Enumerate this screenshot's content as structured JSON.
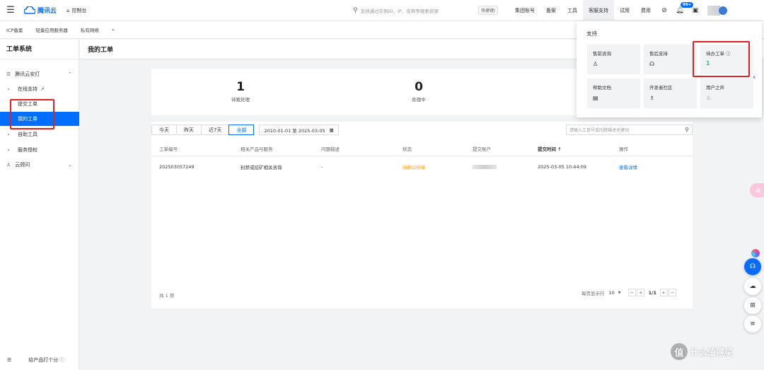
{
  "topbar": {
    "brand": "腾讯云",
    "console": "控制台",
    "search_placeholder": "支持通过实例ID、IP、名称等搜索资源",
    "shortcut": "快捷键/",
    "nav": [
      "集团账号",
      "备案",
      "工具",
      "客服支持",
      "试用",
      "费用"
    ],
    "notice_badge": "99+"
  },
  "subbar": {
    "items": [
      "ICP备案",
      "轻量应用服务器",
      "私有网络",
      "«"
    ]
  },
  "sidebar": {
    "title": "工单系统",
    "group": "腾讯云安灯",
    "items": [
      "在线支持",
      "提交工单",
      "我的工单",
      "自助工具",
      "服务授权",
      "云顾问"
    ],
    "bottom_label": "给产品打个分"
  },
  "main": {
    "title": "我的工单",
    "stats": [
      {
        "value": "1",
        "label": "待我处理"
      },
      {
        "value": "0",
        "label": "处理中"
      }
    ],
    "filters": [
      "今天",
      "昨天",
      "近7天",
      "全部"
    ],
    "date_range": "2010-01-01 至 2025-03-05",
    "search_placeholder": "请输入工单号或问题描述关键词",
    "columns": [
      "工单编号",
      "相关产品与服务",
      "问题描述",
      "状态",
      "提交账户",
      "提交时间 ↑",
      "操作"
    ],
    "rows": [
      {
        "id": "202503057249",
        "product": "封禁或挖矿相关咨询",
        "desc": "-",
        "status": "待确认结单",
        "time": "2025-03-05 10:44:09",
        "action": "查看详情"
      }
    ],
    "total": "共 1 项",
    "page_size_label": "每页显示行",
    "page_size": "10",
    "page_indicator": "1/1"
  },
  "dropdown": {
    "title": "支持",
    "cards": [
      {
        "label": "售前咨询"
      },
      {
        "label": "售后支持"
      },
      {
        "label": "待办工单",
        "count": "1"
      },
      {
        "label": "帮助文档"
      },
      {
        "label": "开发者社区"
      },
      {
        "label": "用户之声"
      }
    ]
  },
  "watermark": "什么值得买",
  "colors": {
    "accent": "#006eff",
    "warning": "#ff9c19",
    "success": "#29cc85",
    "highlight_box": "#e02020"
  }
}
